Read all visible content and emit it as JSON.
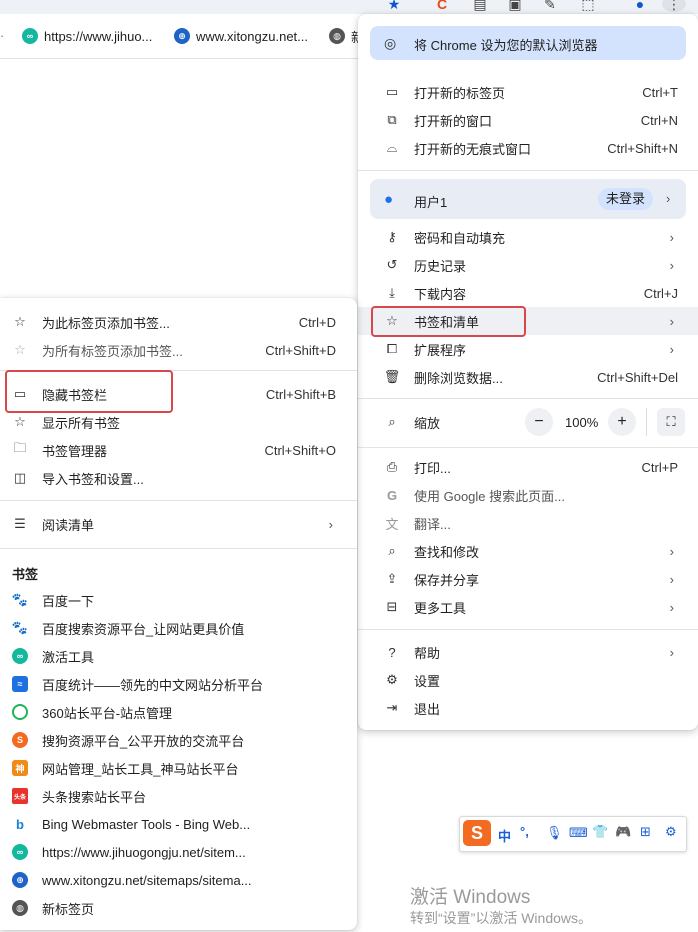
{
  "toolbar": {
    "icons": [
      "star-icon",
      "c-logo-icon",
      "document-icon",
      "image-icon",
      "edit-icon",
      "extension-icon",
      "profile-icon",
      "more-vert-icon"
    ]
  },
  "bookmark_bar": {
    "items": [
      {
        "label": "https://www.jihuo...",
        "icon": "jihuo-favicon"
      },
      {
        "label": "www.xitongzu.net...",
        "icon": "xitongzu-favicon"
      },
      {
        "label": "新",
        "icon": "globe-icon"
      }
    ]
  },
  "chrome_menu": {
    "default_browser": "将 Chrome 设为您的默认浏览器",
    "new_tab": {
      "label": "打开新的标签页",
      "shortcut": "Ctrl+T"
    },
    "new_window": {
      "label": "打开新的窗口",
      "shortcut": "Ctrl+N"
    },
    "incognito": {
      "label": "打开新的无痕式窗口",
      "shortcut": "Ctrl+Shift+N"
    },
    "profile": {
      "name": "用户1",
      "status": "未登录"
    },
    "passwords": {
      "label": "密码和自动填充"
    },
    "history": {
      "label": "历史记录"
    },
    "downloads": {
      "label": "下载内容",
      "shortcut": "Ctrl+J"
    },
    "bookmarks": {
      "label": "书签和清单"
    },
    "extensions": {
      "label": "扩展程序"
    },
    "clear_data": {
      "label": "删除浏览数据...",
      "shortcut": "Ctrl+Shift+Del"
    },
    "zoom": {
      "label": "缩放",
      "minus": "−",
      "value": "100%",
      "plus": "+"
    },
    "print": {
      "label": "打印...",
      "shortcut": "Ctrl+P"
    },
    "google_search": {
      "label": "使用 Google 搜索此页面..."
    },
    "translate": {
      "label": "翻译..."
    },
    "find": {
      "label": "查找和修改"
    },
    "save_share": {
      "label": "保存并分享"
    },
    "more_tools": {
      "label": "更多工具"
    },
    "help": {
      "label": "帮助"
    },
    "settings": {
      "label": "设置"
    },
    "exit": {
      "label": "退出"
    }
  },
  "bookmarks_submenu": {
    "add_bookmark": {
      "label": "为此标签页添加书签...",
      "shortcut": "Ctrl+D"
    },
    "add_all": {
      "label": "为所有标签页添加书签...",
      "shortcut": "Ctrl+Shift+D"
    },
    "hide_bar": {
      "label": "隐藏书签栏",
      "shortcut": "Ctrl+Shift+B"
    },
    "show_all": {
      "label": "显示所有书签"
    },
    "manager": {
      "label": "书签管理器",
      "shortcut": "Ctrl+Shift+O"
    },
    "import": {
      "label": "导入书签和设置..."
    },
    "reading_list": {
      "label": "阅读清单"
    },
    "section_title": "书签",
    "items": [
      {
        "label": "百度一下",
        "icon": "baidu-favicon"
      },
      {
        "label": "百度搜索资源平台_让网站更具价值",
        "icon": "baidu-ziyuan-favicon"
      },
      {
        "label": "激活工具",
        "icon": "jihuo-favicon"
      },
      {
        "label": "百度统计——领先的中文网站分析平台",
        "icon": "baidu-tongji-favicon"
      },
      {
        "label": "360站长平台-站点管理",
        "icon": "360-favicon"
      },
      {
        "label": "搜狗资源平台_公平开放的交流平台",
        "icon": "sogou-favicon"
      },
      {
        "label": "网站管理_站长工具_神马站长平台",
        "icon": "shenma-favicon"
      },
      {
        "label": "头条搜索站长平台",
        "icon": "toutiao-favicon"
      },
      {
        "label": "Bing Webmaster Tools - Bing Web...",
        "icon": "bing-favicon"
      },
      {
        "label": "https://www.jihuogongju.net/sitem...",
        "icon": "jihuo-favicon"
      },
      {
        "label": "www.xitongzu.net/sitemaps/sitema...",
        "icon": "xitongzu-favicon"
      },
      {
        "label": "新标签页",
        "icon": "globe-icon"
      }
    ]
  },
  "ime_bar": {
    "chinese": "中",
    "punct": "°,"
  },
  "watermark": {
    "title": "激活 Windows",
    "subtitle": "转到“设置”以激活 Windows。"
  },
  "colors": {
    "highlight": "#d8474b",
    "accent": "#0b57d0",
    "menu_blue": "#d3e3fd"
  }
}
